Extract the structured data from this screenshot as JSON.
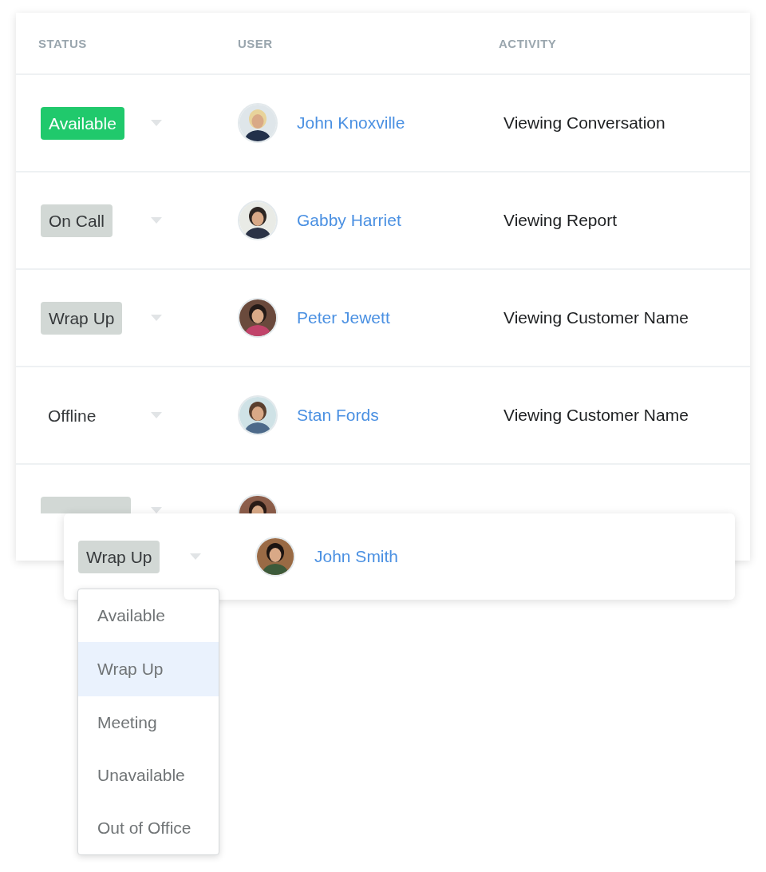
{
  "table": {
    "columns": [
      "STATUS",
      "USER",
      "ACTIVITY"
    ],
    "rows": [
      {
        "status": {
          "label": "Available",
          "kind": "available"
        },
        "user": "John Knoxville",
        "activity": "Viewing Conversation"
      },
      {
        "status": {
          "label": "On Call",
          "kind": "busy"
        },
        "user": "Gabby Harriet",
        "activity": "Viewing Report"
      },
      {
        "status": {
          "label": "Wrap Up",
          "kind": "busy"
        },
        "user": "Peter Jewett",
        "activity": "Viewing Customer Name"
      },
      {
        "status": {
          "label": "Offline",
          "kind": "plain"
        },
        "user": "Stan Fords",
        "activity": "Viewing Customer Name"
      },
      {
        "status": {
          "kind": "busy"
        }
      }
    ]
  },
  "floating_row": {
    "status": {
      "label": "Wrap Up",
      "kind": "busy"
    },
    "user": "John Smith"
  },
  "status_menu": {
    "items": [
      {
        "label": "Available",
        "selected": false
      },
      {
        "label": "Wrap Up",
        "selected": true
      },
      {
        "label": "Meeting",
        "selected": false
      },
      {
        "label": "Unavailable",
        "selected": false
      },
      {
        "label": "Out of Office",
        "selected": false
      }
    ]
  }
}
